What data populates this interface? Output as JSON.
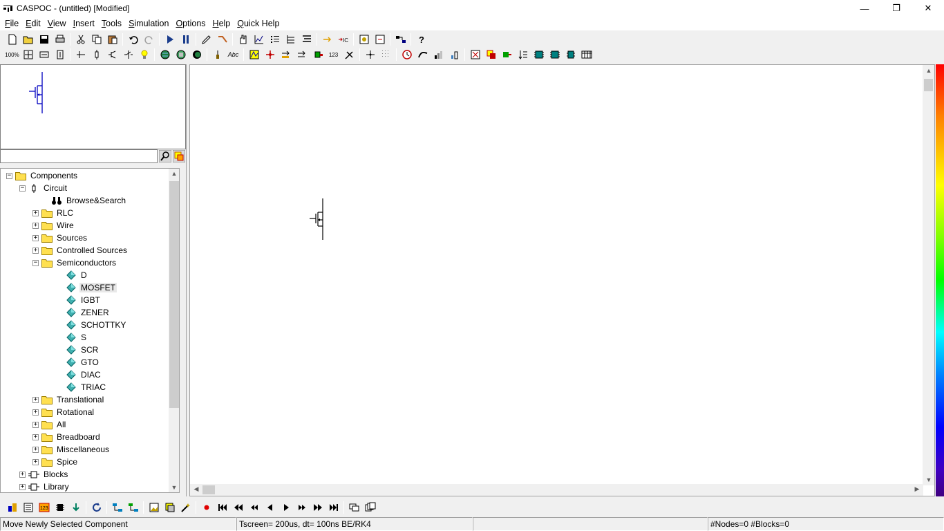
{
  "window": {
    "title": "CASPOC - (untitled) [Modified]",
    "app_icon_text": "CASPOC",
    "minimize": "—",
    "restore": "❐",
    "close": "✕"
  },
  "menu": [
    {
      "label": "File",
      "key": "F",
      "rest": "ile"
    },
    {
      "label": "Edit",
      "key": "E",
      "rest": "dit"
    },
    {
      "label": "View",
      "key": "V",
      "rest": "iew"
    },
    {
      "label": "Insert",
      "key": "I",
      "rest": "nsert"
    },
    {
      "label": "Tools",
      "key": "T",
      "rest": "ools"
    },
    {
      "label": "Simulation",
      "key": "S",
      "rest": "imulation"
    },
    {
      "label": "Options",
      "key": "O",
      "rest": "ptions"
    },
    {
      "label": "Help",
      "key": "H",
      "rest": "elp"
    },
    {
      "label": "Quick Help",
      "key": "Q",
      "rest": "uick Help"
    }
  ],
  "toolbar2": {
    "zoom_label": "100%",
    "abc_label": "Abc",
    "count_label": "123"
  },
  "search": {
    "value": ""
  },
  "tree": {
    "root": "Components",
    "circuit": "Circuit",
    "browse": "Browse&Search",
    "folders_top": [
      "RLC",
      "Wire",
      "Sources",
      "Controlled Sources"
    ],
    "semiconductors": "Semiconductors",
    "devices": [
      "D",
      "MOSFET",
      "IGBT",
      "ZENER",
      "SCHOTTKY",
      "S",
      "SCR",
      "GTO",
      "DIAC",
      "TRIAC"
    ],
    "selected_device": "MOSFET",
    "folders_bottom": [
      "Translational",
      "Rotational",
      "All",
      "Breadboard",
      "Miscellaneous",
      "Spice"
    ],
    "blocks": "Blocks",
    "library": "Library"
  },
  "status": {
    "message": "Move Newly Selected Component",
    "sim": "Tscreen= 200us, dt= 100ns BE/RK4",
    "empty": "",
    "counts": "#Nodes=0 #Blocks=0"
  },
  "colors": {
    "accent_blue": "#0000c0",
    "tree_selected": "#e8e8e8"
  }
}
